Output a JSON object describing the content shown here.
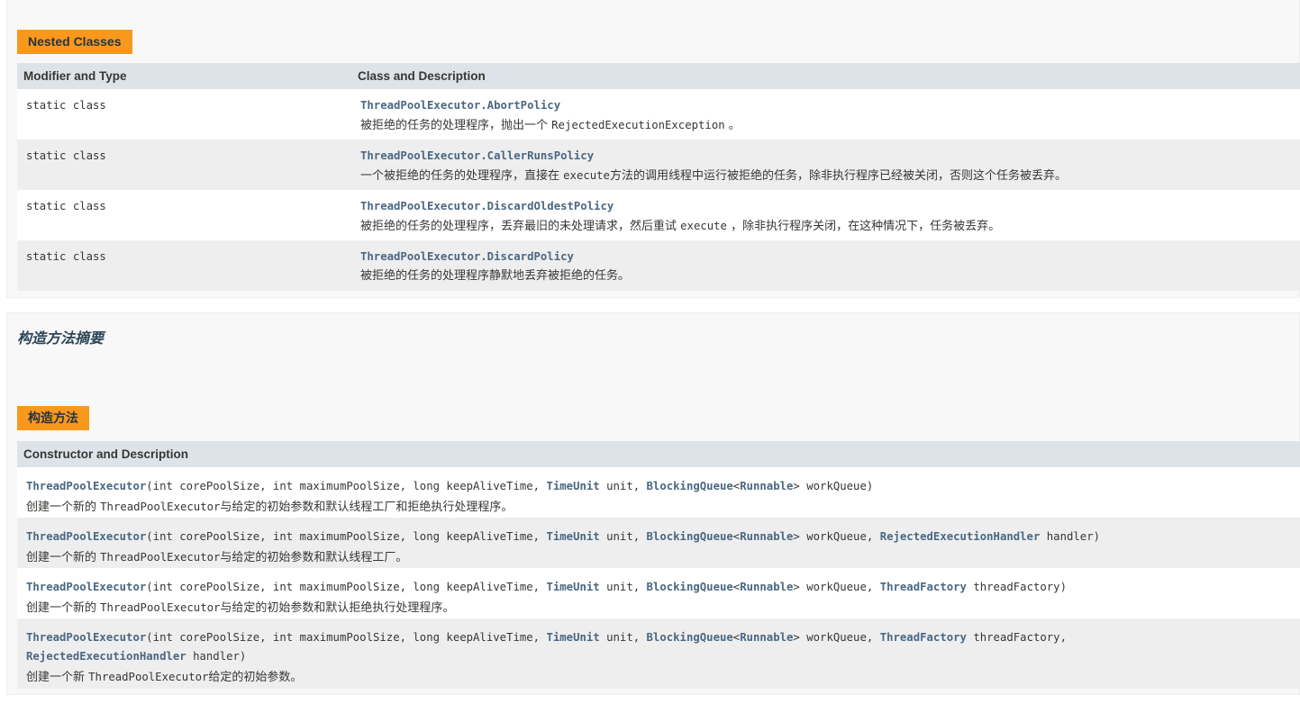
{
  "nested": {
    "caption": "Nested Classes",
    "col_modifier": "Modifier and Type",
    "col_class": "Class and Description",
    "rows": [
      {
        "modifier": "static class",
        "name": "ThreadPoolExecutor.AbortPolicy",
        "desc_pre": "被拒绝的任务的处理程序，抛出一个 ",
        "desc_code": "RejectedExecutionException",
        "desc_post": " 。"
      },
      {
        "modifier": "static class",
        "name": "ThreadPoolExecutor.CallerRunsPolicy",
        "desc_pre": "一个被拒绝的任务的处理程序，直接在 ",
        "desc_code": "execute",
        "desc_post": "方法的调用线程中运行被拒绝的任务，除非执行程序已经被关闭，否则这个任务被丢弃。"
      },
      {
        "modifier": "static class",
        "name": "ThreadPoolExecutor.DiscardOldestPolicy",
        "desc_pre": "被拒绝的任务的处理程序，丢弃最旧的未处理请求，然后重试 ",
        "desc_code": "execute",
        "desc_post": " ，除非执行程序关闭，在这种情况下，任务被丢弃。"
      },
      {
        "modifier": "static class",
        "name": "ThreadPoolExecutor.DiscardPolicy",
        "desc_pre": "被拒绝的任务的处理程序静默地丢弃被拒绝的任务。",
        "desc_code": "",
        "desc_post": ""
      }
    ]
  },
  "ctor": {
    "heading": "构造方法摘要",
    "caption": "构造方法",
    "col_header": "Constructor and Description",
    "tokens": {
      "name": "ThreadPoolExecutor",
      "open": "(int corePoolSize, int maximumPoolSize, long keepAliveTime, ",
      "timeunit": "TimeUnit",
      "unit": " unit, ",
      "bq": "BlockingQueue",
      "lt": "<",
      "runnable": "Runnable",
      "gt": ">",
      "wq": " workQueue",
      "comma": ", ",
      "close": ")",
      "reh": "RejectedExecutionHandler",
      "handler": " handler",
      "tf": "ThreadFactory",
      "tfp": " threadFactory",
      "tfp_comma": " threadFactory,"
    },
    "rows": [
      {
        "desc_pre": "创建一个新的 ",
        "desc_code": "ThreadPoolExecutor",
        "desc_post": "与给定的初始参数和默认线程工厂和拒绝执行处理程序。"
      },
      {
        "desc_pre": "创建一个新的 ",
        "desc_code": "ThreadPoolExecutor",
        "desc_post": "与给定的初始参数和默认线程工厂。"
      },
      {
        "desc_pre": "创建一个新的 ",
        "desc_code": "ThreadPoolExecutor",
        "desc_post": "与给定的初始参数和默认拒绝执行处理程序。"
      },
      {
        "desc_pre": "创建一个新 ",
        "desc_code": "ThreadPoolExecutor",
        "desc_post": "给定的初始参数。"
      }
    ]
  },
  "colors": {
    "caption_bg": "#f8981d",
    "header_bg": "#dee3e9",
    "row_alt_bg": "#eeeeef",
    "link": "#4a6782"
  }
}
